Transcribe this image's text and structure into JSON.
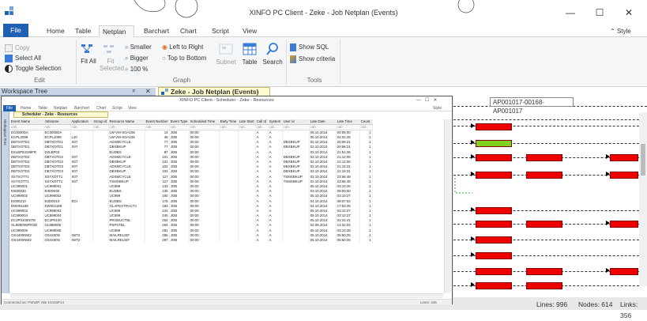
{
  "window": {
    "title": "XINFO PC Client - Zeke - Job Netplan (Events)",
    "minimize": "—",
    "maximize": "☐",
    "close": "✕"
  },
  "menu": {
    "file": "File",
    "items": [
      "Home",
      "Table",
      "Netplan",
      "Barchart",
      "Chart",
      "Script",
      "View"
    ],
    "active": "Netplan",
    "style": "Style"
  },
  "ribbon": {
    "edit": {
      "label": "Edit",
      "copy": "Copy",
      "select_all": "Select All",
      "toggle_selection": "Toggle Selection"
    },
    "graph": {
      "label": "Graph",
      "fit_all": "Fit All",
      "fit_selected": "Fit Selected",
      "smaller": "Smaller",
      "bigger": "Bigger",
      "zoom": "100 %",
      "left_to_right": "Left to Right",
      "top_to_bottom": "Top to Bottom",
      "subnet": "Subnet",
      "table": "Table",
      "search": "Search"
    },
    "tools": {
      "label": "Tools",
      "show_sql": "Show SQL",
      "show_criteria": "Show criteria"
    }
  },
  "workspace": {
    "title": "Workspace Tree",
    "pin": "ᵖ",
    "close": "✕"
  },
  "doc_tab": {
    "label": "Zeke - Job Netplan (Events)",
    "close": "✕"
  },
  "inner": {
    "title": "XINFO PC Client - Scheduler - Zeke - Resources",
    "menu": [
      "Home",
      "Table",
      "Netplan",
      "Barchart",
      "Chart",
      "Script",
      "View"
    ],
    "file": "File",
    "style": "Style",
    "tab": "Scheduler - Zeke - Resources",
    "side": "Workspace Tree",
    "status": "Connected as: PSNZP, Nte 10415P14",
    "lines": "Lines: 426",
    "columns": [
      "Event Name",
      "Jobname",
      "Application",
      "Group id",
      "Resource Name",
      "Event Number",
      "Event Type",
      "Scheduled Time",
      "Early Time",
      "Late Start",
      "Call Id",
      "System",
      "User id",
      "Late Date",
      "Late Time",
      "Count"
    ],
    "filter": "cab",
    "rows": [
      [
        "EC0000DA",
        "EC0000DA",
        "",
        "",
        "LW-VM-SOA106",
        "14",
        "JOB",
        "00:00",
        "",
        "",
        "A",
        "A",
        "",
        "06.10.2014",
        "00:05:00",
        "1"
      ],
      [
        "ECPL2099",
        "ECPL2099",
        "L20",
        "",
        "LW-VM-SOA106",
        "46",
        "JOB",
        "00:00",
        "",
        "",
        "A",
        "A",
        "",
        "05.10.2014",
        "04:01:25",
        "1"
      ],
      [
        "DBTXOTD1",
        "DBTXOTD1",
        "X07",
        "",
        "ADSMCYCLE",
        "77",
        "JOB",
        "00:00",
        "",
        "",
        "A",
        "A",
        "DBXBKUP",
        "02.10.2014",
        "20:59:21",
        "1"
      ],
      [
        "DBTXOTD1",
        "DBTXOTD1",
        "X07",
        "",
        "DBXBKUP",
        "77",
        "JOB",
        "00:00",
        "",
        "",
        "A",
        "A",
        "DBXBKUP",
        "02.10.2014",
        "20:59:21",
        "1"
      ],
      [
        "D2LBP03199FR",
        "D2LBP03",
        "",
        "",
        "EUDBS",
        "87",
        "JOB",
        "00:00",
        "",
        "",
        "A",
        "A",
        "",
        "03.10.2014",
        "21:51:26",
        "1"
      ],
      [
        "DBTXOTD2",
        "DBTXOTD2",
        "X07",
        "",
        "ADSMCYCLE",
        "101",
        "JOB",
        "00:00",
        "",
        "",
        "A",
        "A",
        "DBXBKUP",
        "02.10.2014",
        "21:12:06",
        "1"
      ],
      [
        "DBTXOTD2",
        "DBTXOTD2",
        "X07",
        "",
        "DBXBKUP",
        "101",
        "JOB",
        "00:00",
        "",
        "",
        "A",
        "A",
        "DBXBKUP",
        "02.10.2014",
        "21:12:06",
        "1"
      ],
      [
        "DBTXOTD3",
        "DBTXOTD3",
        "X07",
        "",
        "ADSMCYCLE",
        "102",
        "JOB",
        "00:00",
        "",
        "",
        "A",
        "A",
        "DBXBKUP",
        "02.10.2014",
        "21:15:31",
        "1"
      ],
      [
        "DBTXOTD3",
        "DBTXOTD3",
        "X07",
        "",
        "DBXBKUP",
        "102",
        "JOB",
        "00:00",
        "",
        "",
        "A",
        "A",
        "DBXBKUP",
        "02.10.2014",
        "21:15:31",
        "1"
      ],
      [
        "SSTXOTT1",
        "SSTXOTT1",
        "X07",
        "",
        "ADSMCYCLE",
        "117",
        "JOB",
        "00:00",
        "",
        "",
        "A",
        "A",
        "TSMXBKUP",
        "02.10.2014",
        "23:56:48",
        "1"
      ],
      [
        "SSTXOTT1",
        "SSTXOTT1",
        "X07",
        "",
        "TSMXBKUP",
        "117",
        "JOB",
        "00:00",
        "",
        "",
        "A",
        "A",
        "TSMXBKUP",
        "02.10.2014",
        "23:56:48",
        "1"
      ],
      [
        "UC999001",
        "UC999001",
        "",
        "",
        "UC999",
        "133",
        "JOB",
        "00:00",
        "",
        "",
        "A",
        "A",
        "",
        "05.10.2014",
        "03:10:26",
        "1"
      ],
      [
        "EI500030",
        "EI500030",
        "",
        "",
        "EUDBS",
        "135",
        "JOB",
        "00:00",
        "",
        "",
        "A",
        "A",
        "",
        "03.10.2014",
        "09:00:00",
        "1"
      ],
      [
        "UC999002",
        "UC999002",
        "",
        "",
        "UC999",
        "160",
        "JOB",
        "00:00",
        "",
        "",
        "A",
        "A",
        "",
        "05.10.2014",
        "03:10:27",
        "1"
      ],
      [
        "EI000210",
        "EI000210",
        "EDI",
        "",
        "EUDBS",
        "178",
        "JOB",
        "00:00",
        "",
        "",
        "A",
        "A",
        "",
        "04.10.2014",
        "08:07:53",
        "1"
      ],
      [
        "DW001188",
        "DW001188",
        "",
        "",
        "OLAPEXTRACT1",
        "183",
        "JOB",
        "00:00",
        "",
        "",
        "A",
        "A",
        "",
        "04.10.2014",
        "17:53:25",
        "1"
      ],
      [
        "UC999003",
        "UC999003",
        "",
        "",
        "UC999",
        "244",
        "JOB",
        "00:00",
        "",
        "",
        "A",
        "A",
        "",
        "05.10.2014",
        "03:10:27",
        "1"
      ],
      [
        "UC999004",
        "UC999004",
        "",
        "",
        "UC999",
        "245",
        "JOB",
        "00:00",
        "",
        "",
        "A",
        "A",
        "",
        "05.10.2014",
        "03:10:27",
        "1"
      ],
      [
        "EC2P0100NITE",
        "EC2P0100",
        "",
        "",
        "PRODUCTBL",
        "254",
        "JOB",
        "00:00",
        "",
        "",
        "A",
        "A",
        "",
        "05.10.2014",
        "01:31:41",
        "1"
      ],
      [
        "GL888005PROD",
        "GL888005",
        "",
        "",
        "PSPSTBL",
        "264",
        "JOB",
        "00:00",
        "",
        "",
        "A",
        "A",
        "",
        "02.09.2014",
        "14:31:02",
        "1"
      ],
      [
        "UC999005",
        "UC999005",
        "",
        "",
        "UC999",
        "281",
        "JOB",
        "00:00",
        "",
        "",
        "A",
        "A",
        "",
        "05.10.2014",
        "03:10:28",
        "1"
      ],
      [
        "OS4400NW2",
        "OS4400N",
        "INIT2",
        "",
        "MAILRELIEF",
        "285",
        "JOB",
        "00:00",
        "",
        "",
        "A",
        "A",
        "",
        "05.10.2014",
        "05:50:25",
        "1"
      ],
      [
        "OS4400NW2",
        "OS4400N",
        "INIT2",
        "",
        "MAILRELIEF",
        "287",
        "JOB",
        "00:00",
        "",
        "",
        "A",
        "A",
        "",
        "05.10.2014",
        "05:50:25",
        "1"
      ]
    ]
  },
  "tooltip": "AP001017-00168-AP001017",
  "status": {
    "lines": "Lines: 996",
    "nodes": "Nodes: 614",
    "links": "Links: 356"
  },
  "colors": {
    "accent": "#1f5fb4",
    "node_red": "#e00000",
    "node_green": "#7ed321"
  }
}
